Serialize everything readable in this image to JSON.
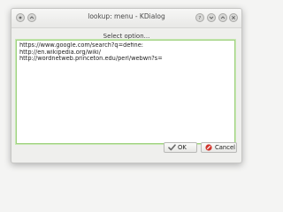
{
  "window": {
    "title": "lookup: menu - KDialog"
  },
  "dialog": {
    "prompt": "Select option...",
    "options": [
      "https://www.google.com/search?q=define:",
      "http://en.wikipedia.org/wiki/",
      "http://wordnetweb.princeton.edu/perl/webwn?s="
    ]
  },
  "buttons": {
    "ok_label": "OK",
    "cancel_label": "Cancel"
  },
  "icons": {
    "window_menu": "window-menu-icon",
    "keep_above": "keep-above-icon",
    "help": "help-icon",
    "minimize": "minimize-icon",
    "maximize": "maximize-icon",
    "close": "close-icon",
    "ok": "checkmark-icon",
    "cancel": "cancel-icon"
  },
  "colors": {
    "focus_border": "#9fd17f",
    "cancel_icon": "#d0342c"
  }
}
